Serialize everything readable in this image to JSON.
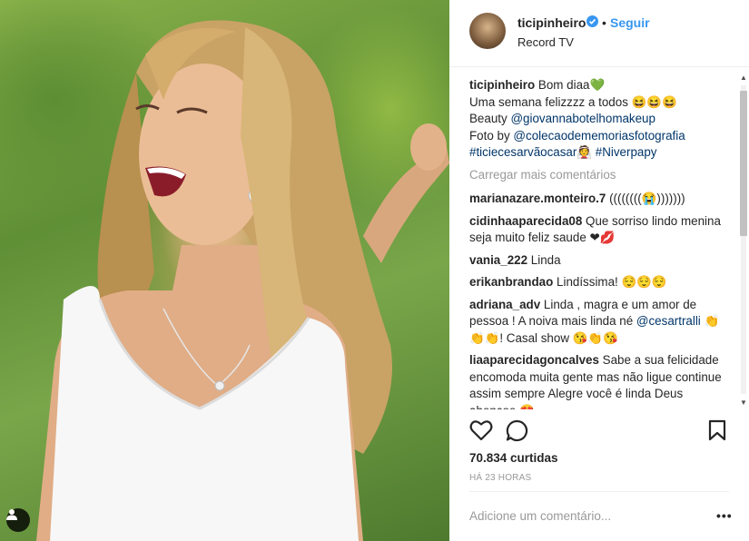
{
  "header": {
    "username": "ticipinheiro",
    "separator": "•",
    "follow_label": "Seguir",
    "location": "Record TV",
    "verified_icon": "verified-badge-icon"
  },
  "caption": {
    "username": "ticipinheiro",
    "line1": "Bom diaa",
    "line1_emoji": "💚",
    "line2": "Uma semana felizzzz a todos",
    "line2_emoji": "😆😆😆",
    "line3_prefix": "Beauty",
    "line3_link": "@giovannabotelhomakeup",
    "line4_prefix": "Foto by",
    "line4_link": "@colecaodememoriasfotografia",
    "line5_tag1": "#ticiecesarvãocasar",
    "line5_emoji": "👰",
    "line5_tag2": "#Niverpapy"
  },
  "load_more": "Carregar mais comentários",
  "comments": [
    {
      "user": "marianazare.monteiro.7",
      "text": "((((((((😭)))))))"
    },
    {
      "user": "cidinhaaparecida08",
      "text": "Que sorriso lindo menina seja muito feliz saude ❤💋"
    },
    {
      "user": "vania_222",
      "text": "Linda"
    },
    {
      "user": "erikanbrandao",
      "text": "Lindíssima! 😌😌😌"
    },
    {
      "user": "adriana_adv",
      "text": "Linda , magra e um amor de pessoa ! A noiva mais linda né",
      "link": "@cesartralli",
      "text2": "👏👏👏! Casal show 😘👏😘"
    },
    {
      "user": "liaaparecidagoncalves",
      "text": "Sabe a sua felicidade encomoda muita gente mas não ligue continue assim sempre Alegre você é linda Deus abencoe 😍"
    }
  ],
  "actions": {
    "like_icon": "heart-icon",
    "comment_icon": "comment-bubble-icon",
    "save_icon": "bookmark-icon"
  },
  "likes": "70.834 curtidas",
  "timestamp": "HÁ 23 HORAS",
  "add_comment_placeholder": "Adicione um comentário...",
  "more_options": "•••",
  "colors": {
    "link": "#003569",
    "follow": "#3897f0",
    "muted": "#999999",
    "text": "#262626"
  }
}
